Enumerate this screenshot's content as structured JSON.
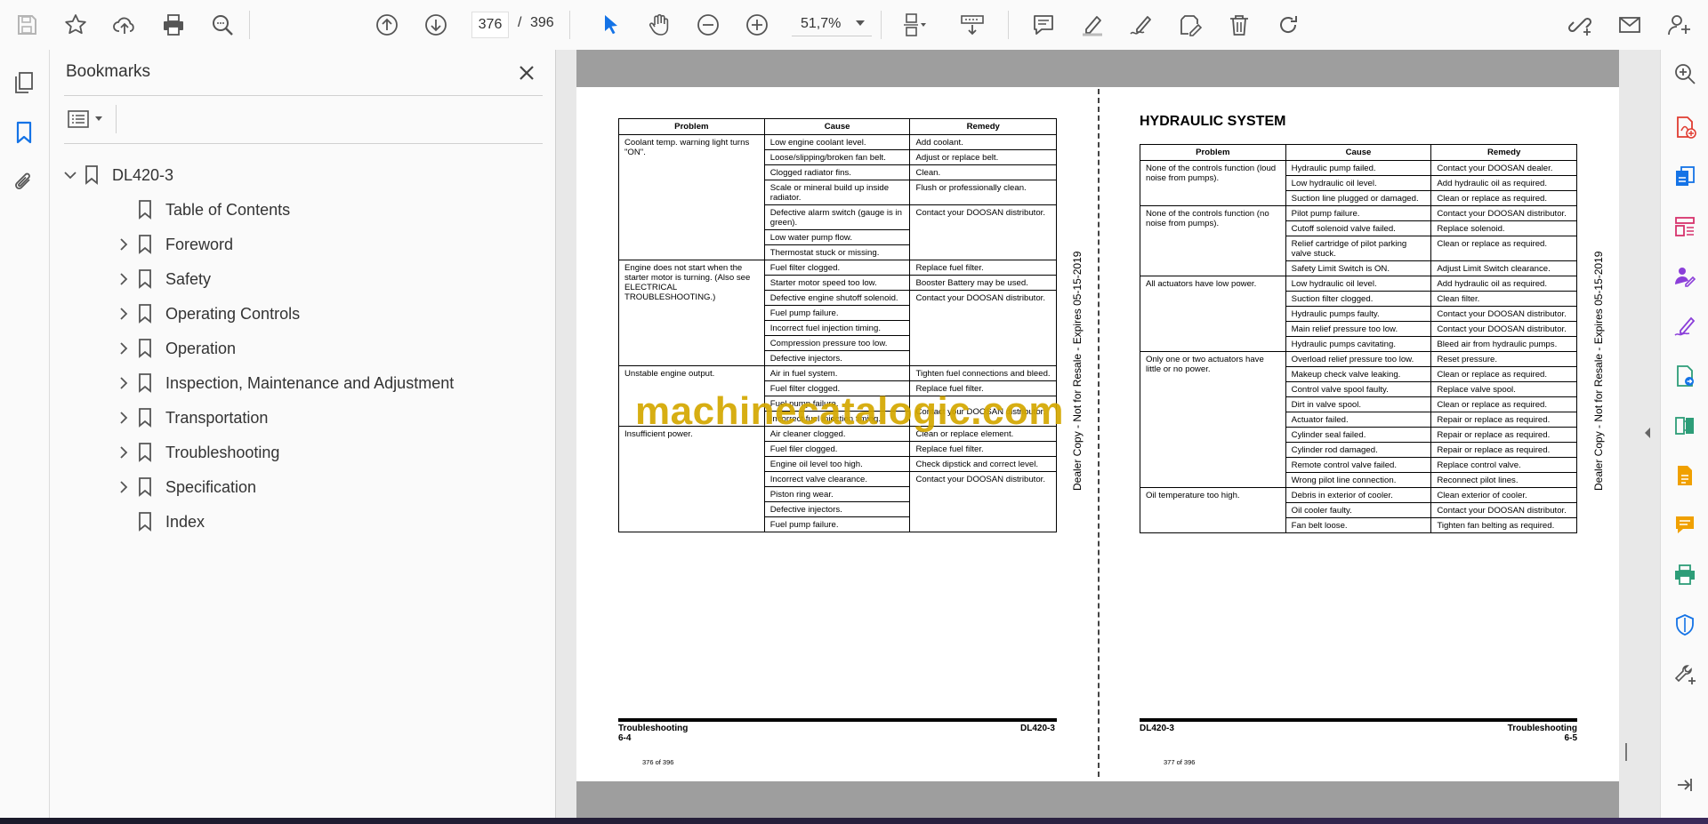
{
  "toolbar": {
    "current_page": "376",
    "page_separator": "/",
    "total_pages": "396",
    "zoom": "51,7%"
  },
  "bookmarks": {
    "title": "Bookmarks",
    "root": "DL420-3",
    "items": [
      {
        "label": "Table of Contents",
        "expandable": false
      },
      {
        "label": "Foreword",
        "expandable": true
      },
      {
        "label": "Safety",
        "expandable": true
      },
      {
        "label": "Operating Controls",
        "expandable": true
      },
      {
        "label": "Operation",
        "expandable": true
      },
      {
        "label": "Inspection, Maintenance and Adjustment",
        "expandable": true
      },
      {
        "label": "Transportation",
        "expandable": true
      },
      {
        "label": "Troubleshooting",
        "expandable": true
      },
      {
        "label": "Specification",
        "expandable": true
      },
      {
        "label": "Index",
        "expandable": false
      }
    ]
  },
  "left_page": {
    "headers": [
      "Problem",
      "Cause",
      "Remedy"
    ],
    "footer_left": "Troubleshooting",
    "footer_left_num": "6-4",
    "footer_right": "DL420-3",
    "page_of": "376 of 396",
    "stamp": "Dealer Copy - Not for Resale - Expires 05-15-2019",
    "groups": [
      {
        "problem": "Coolant temp. warning light turns \"ON\".",
        "rows": [
          [
            "Low engine coolant level.",
            "Add coolant."
          ],
          [
            "Loose/slipping/broken fan belt.",
            "Adjust or replace belt."
          ],
          [
            "Clogged radiator fins.",
            "Clean."
          ],
          [
            "Scale or mineral build up inside radiator.",
            "Flush or professionally clean."
          ],
          [
            "Defective alarm switch (gauge is in green).",
            "Contact your DOOSAN distributor."
          ],
          [
            "Low water pump flow.",
            ""
          ],
          [
            "Thermostat stuck or missing.",
            ""
          ]
        ]
      },
      {
        "problem": "Engine does not start when the starter motor is turning. (Also see ELECTRICAL TROUBLESHOOTING.)",
        "rows": [
          [
            "Fuel filter clogged.",
            "Replace fuel filter."
          ],
          [
            "Starter motor speed too low.",
            "Booster Battery may be used."
          ],
          [
            "Defective engine shutoff solenoid.",
            "Contact your DOOSAN distributor."
          ],
          [
            "Fuel pump failure.",
            ""
          ],
          [
            "Incorrect fuel injection timing.",
            ""
          ],
          [
            "Compression pressure too low.",
            ""
          ],
          [
            "Defective injectors.",
            ""
          ]
        ]
      },
      {
        "problem": "Unstable engine output.",
        "rows": [
          [
            "Air in fuel system.",
            "Tighten fuel connections and bleed."
          ],
          [
            "Fuel filter clogged.",
            "Replace fuel filter."
          ],
          [
            "Fuel pump failure.",
            "Contact your DOOSAN distributor."
          ],
          [
            "Incorrect fuel injection timing.",
            ""
          ]
        ]
      },
      {
        "problem": "Insufficient power.",
        "rows": [
          [
            "Air cleaner clogged.",
            "Clean or replace element."
          ],
          [
            "Fuel filer clogged.",
            "Replace fuel filter."
          ],
          [
            "Engine oil level too high.",
            "Check dipstick and correct level."
          ],
          [
            "Incorrect valve clearance.",
            "Contact your DOOSAN distributor."
          ],
          [
            "Piston ring wear.",
            ""
          ],
          [
            "Defective injectors.",
            ""
          ],
          [
            "Fuel pump failure.",
            ""
          ]
        ]
      }
    ]
  },
  "right_page": {
    "section_title": "HYDRAULIC SYSTEM",
    "headers": [
      "Problem",
      "Cause",
      "Remedy"
    ],
    "footer_left": "DL420-3",
    "footer_right": "Troubleshooting",
    "footer_right_num": "6-5",
    "page_of": "377 of 396",
    "stamp": "Dealer Copy - Not for Resale - Expires 05-15-2019",
    "groups": [
      {
        "problem": "None of the controls function (loud noise from pumps).",
        "rows": [
          [
            "Hydraulic pump failed.",
            "Contact your DOOSAN dealer."
          ],
          [
            "Low hydraulic oil level.",
            "Add hydraulic oil as required."
          ],
          [
            "Suction line plugged or damaged.",
            "Clean or replace as required."
          ]
        ]
      },
      {
        "problem": "None of the controls function (no noise from pumps).",
        "rows": [
          [
            "Pilot pump failure.",
            "Contact your DOOSAN distributor."
          ],
          [
            "Cutoff solenoid valve failed.",
            "Replace solenoid."
          ],
          [
            "Relief cartridge of pilot parking valve stuck.",
            "Clean or replace as required."
          ],
          [
            "Safety Limit Switch is ON.",
            "Adjust Limit Switch clearance."
          ]
        ]
      },
      {
        "problem": "All actuators have low power.",
        "rows": [
          [
            "Low hydraulic oil level.",
            "Add hydraulic oil as required."
          ],
          [
            "Suction filter clogged.",
            "Clean filter."
          ],
          [
            "Hydraulic pumps faulty.",
            "Contact your DOOSAN distributor."
          ],
          [
            "Main relief pressure too low.",
            "Contact your DOOSAN distributor."
          ],
          [
            "Hydraulic pumps cavitating.",
            "Bleed air from hydraulic pumps."
          ]
        ]
      },
      {
        "problem": "Only one or two actuators have little or no power.",
        "rows": [
          [
            "Overload relief pressure too low.",
            "Reset pressure."
          ],
          [
            "Makeup check valve leaking.",
            "Clean or replace as required."
          ],
          [
            "Control valve spool faulty.",
            "Replace valve spool."
          ],
          [
            "Dirt in valve spool.",
            "Clean or replace as required."
          ],
          [
            "Actuator failed.",
            "Repair or replace as required."
          ],
          [
            "Cylinder seal failed.",
            "Repair or replace as required."
          ],
          [
            "Cylinder rod damaged.",
            "Repair or replace as required."
          ],
          [
            "Remote control valve failed.",
            "Replace control valve."
          ],
          [
            "Wrong pilot line connection.",
            "Reconnect pilot lines."
          ]
        ]
      },
      {
        "problem": "Oil temperature too high.",
        "rows": [
          [
            "Debris in exterior of cooler.",
            "Clean exterior of cooler."
          ],
          [
            "Oil cooler faulty.",
            "Contact your DOOSAN distributor."
          ],
          [
            "Fan belt loose.",
            "Tighten fan belting as required."
          ]
        ]
      }
    ]
  },
  "watermark": "machinecatalogic.com"
}
